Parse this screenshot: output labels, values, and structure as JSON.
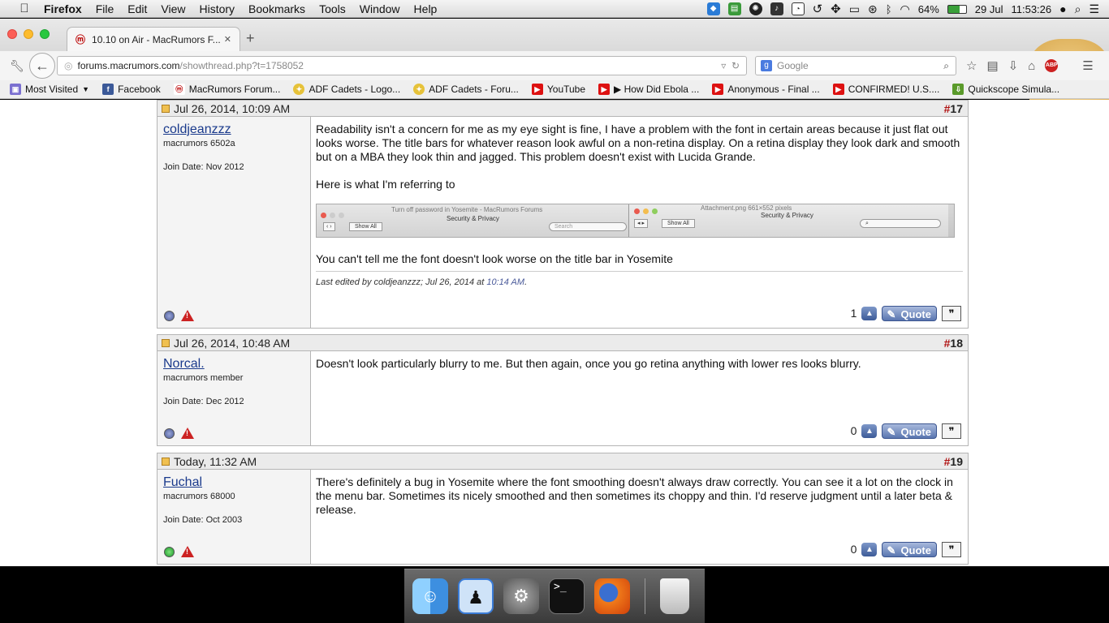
{
  "menubar": {
    "app": "Firefox",
    "items": [
      "File",
      "Edit",
      "View",
      "History",
      "Bookmarks",
      "Tools",
      "Window",
      "Help"
    ],
    "battery": "64%",
    "date": "29 Jul",
    "time": "11:53:26"
  },
  "tab": {
    "title": "10.10 on Air - MacRumors F..."
  },
  "nav": {
    "url_host": "forums.macrumors.com",
    "url_path": "/showthread.php?t=1758052",
    "search_placeholder": "Google"
  },
  "bookmarks": [
    {
      "label": "Most Visited",
      "icon": "folder-icon"
    },
    {
      "label": "Facebook",
      "icon": "facebook-icon"
    },
    {
      "label": "MacRumors Forum...",
      "icon": "macrumors-icon"
    },
    {
      "label": "ADF Cadets - Logo...",
      "icon": "adf-icon"
    },
    {
      "label": "ADF Cadets - Foru...",
      "icon": "adf-icon"
    },
    {
      "label": "YouTube",
      "icon": "youtube-icon"
    },
    {
      "label": "▶ How Did Ebola ...",
      "icon": "youtube-icon"
    },
    {
      "label": "Anonymous - Final ...",
      "icon": "youtube-icon"
    },
    {
      "label": "CONFIRMED! U.S....",
      "icon": "youtube-icon"
    },
    {
      "label": "Quickscope Simula...",
      "icon": "download-icon"
    }
  ],
  "posts": [
    {
      "date": "Jul 26, 2014, 10:09 AM",
      "number": "17",
      "user": "coldjeanzzz",
      "user_title": "macrumors 6502a",
      "join_date": "Join Date: Nov 2012",
      "status_color": "#5b6aa8",
      "paragraphs": [
        "Readability isn't a concern for me as my eye sight is fine, I have a problem with the font in certain areas because it just flat out looks worse. The title bars for whatever reason look awful on a non-retina display. On a retina display they look dark and smooth but on a MBA they look thin and jagged. This problem doesn't exist with Lucida Grande.",
        "Here is what I'm referring to"
      ],
      "screenshot": {
        "left_title": "Security & Privacy",
        "left_button": "Show All",
        "left_search": "Search",
        "left_window_caption": "Turn off password in Yosemite - MacRumors Forums",
        "right_title": "Security & Privacy",
        "right_button": "Show All",
        "right_window_caption": "Attachment.png 661×552 pixels"
      },
      "after_text": "You can't tell me the font doesn't look worse on the title bar in Yosemite",
      "edited": "Last edited by coldjeanzzz; Jul 26, 2014 at",
      "edited_time": "10:14 AM",
      "likes": "1",
      "quote_label": "Quote"
    },
    {
      "date": "Jul 26, 2014, 10:48 AM",
      "number": "18",
      "user": "Norcal.",
      "user_title": "macrumors member",
      "join_date": "Join Date: Dec 2012",
      "status_color": "#5b6aa8",
      "paragraphs": [
        "Doesn't look particularly blurry to me. But then again, once you go retina anything with lower res looks blurry."
      ],
      "likes": "0",
      "quote_label": "Quote"
    },
    {
      "date": "Today, 11:32 AM",
      "number": "19",
      "user": "Fuchal",
      "user_title": "macrumors 68000",
      "join_date": "Join Date: Oct 2003",
      "status_color": "#2ab83a",
      "paragraphs": [
        "There's definitely a bug in Yosemite where the font smoothing doesn't always draw correctly. You can see it a lot on the clock in the menu bar. Sometimes its nicely smoothed and then sometimes its choppy and thin. I'd reserve judgment until a later beta & release."
      ],
      "likes": "0",
      "quote_label": "Quote"
    }
  ],
  "dock": [
    "Finder",
    "Anonymous",
    "System Preferences",
    "Terminal",
    "Firefox",
    "Trash"
  ]
}
